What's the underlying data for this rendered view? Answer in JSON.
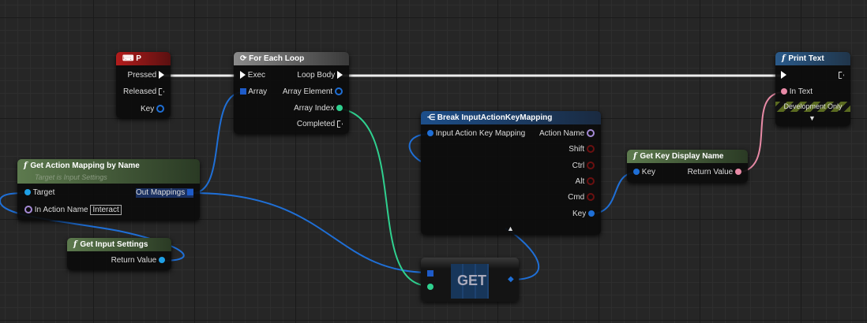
{
  "colors": {
    "exec": "#ffffff",
    "struct": "#1f6fd6",
    "int": "#2fd08f",
    "text": "#e88aa6",
    "bool": "#8a1010",
    "name": "#a58ad6"
  },
  "nodes": {
    "p_event": {
      "title": "P",
      "pins": {
        "pressed": "Pressed",
        "released": "Released",
        "key": "Key"
      }
    },
    "for_each": {
      "title": "For Each Loop",
      "pins": {
        "exec": "Exec",
        "array": "Array",
        "loop_body": "Loop Body",
        "array_element": "Array Element",
        "array_index": "Array Index",
        "completed": "Completed"
      }
    },
    "get_action_mapping": {
      "title": "Get Action Mapping by Name",
      "subtitle": "Target is Input Settings",
      "pins": {
        "target": "Target",
        "in_action_name": "In Action Name",
        "in_action_name_value": "Interact",
        "out_mappings": "Out Mappings"
      }
    },
    "get_input_settings": {
      "title": "Get Input Settings",
      "pins": {
        "return_value": "Return Value"
      }
    },
    "break_mapping": {
      "title": "Break InputActionKeyMapping",
      "pins": {
        "input": "Input Action Key Mapping",
        "action_name": "Action Name",
        "shift": "Shift",
        "ctrl": "Ctrl",
        "alt": "Alt",
        "cmd": "Cmd",
        "key": "Key"
      }
    },
    "get_key_display": {
      "title": "Get Key Display Name",
      "pins": {
        "key": "Key",
        "return_value": "Return Value"
      }
    },
    "print_text": {
      "title": "Print Text",
      "pins": {
        "in_text": "In Text"
      },
      "dev_only": "Development Only"
    },
    "get": {
      "title": "GET"
    }
  }
}
